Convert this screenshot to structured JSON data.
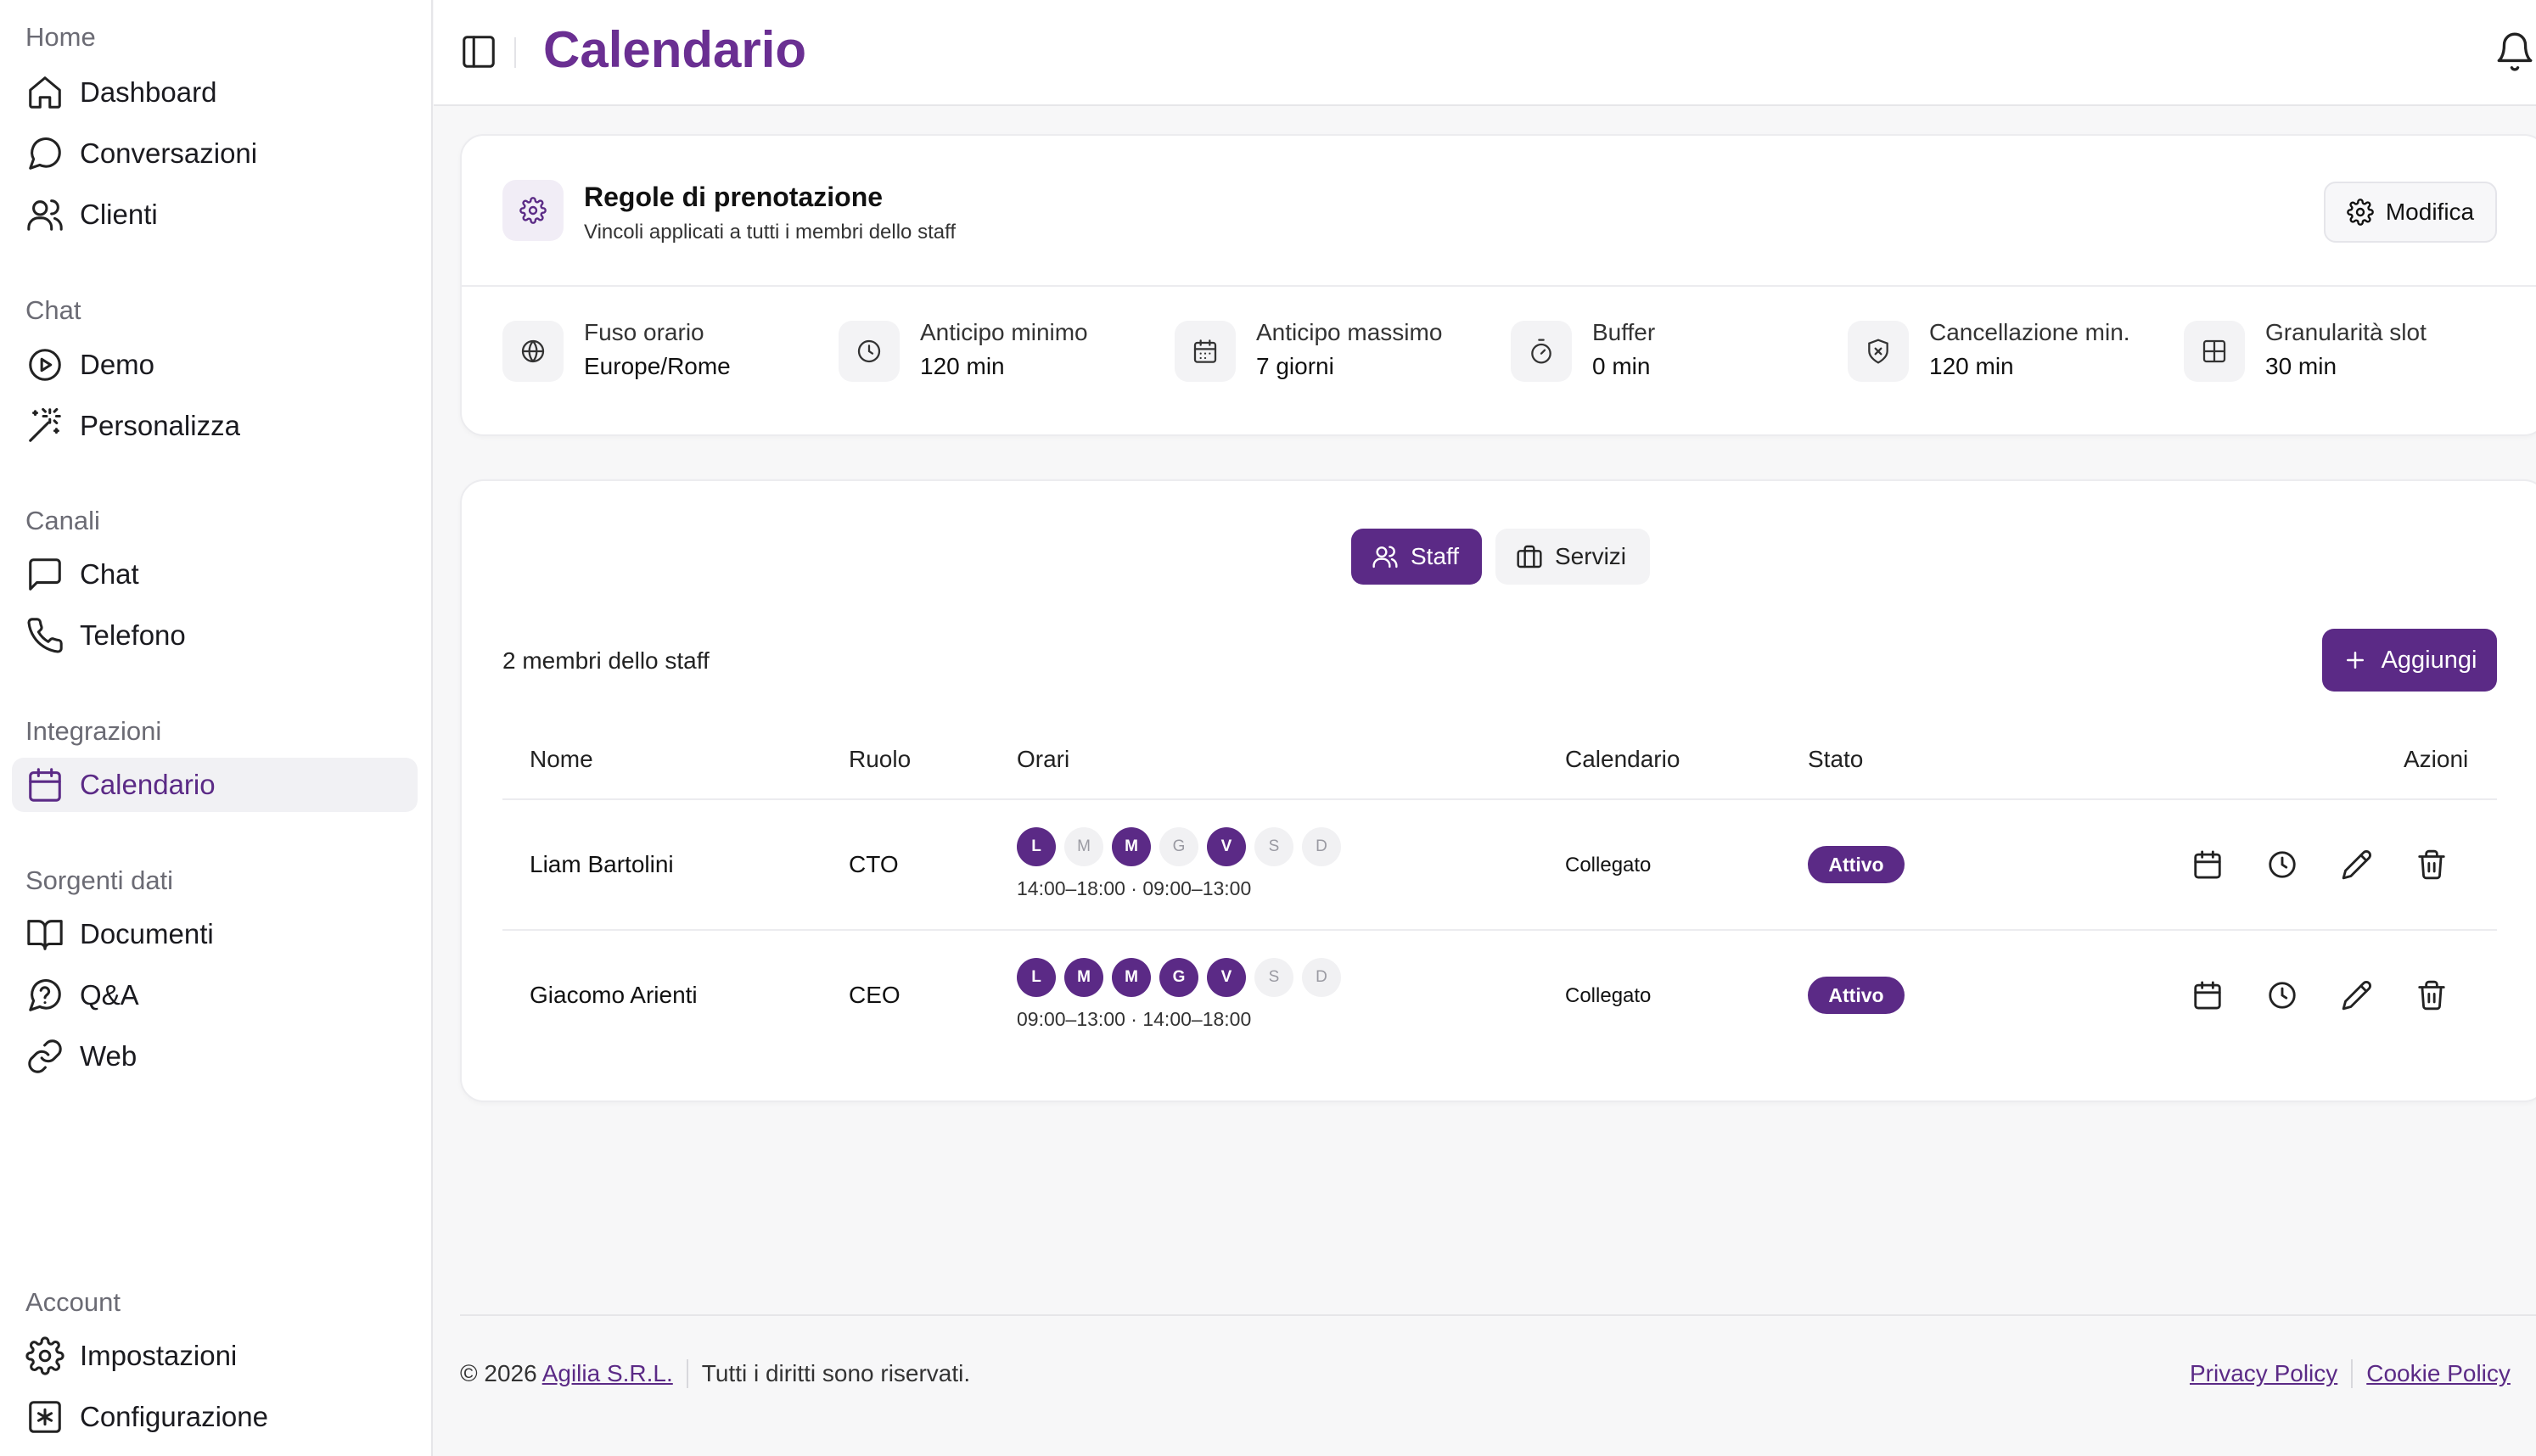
{
  "sidebar": {
    "groups": [
      {
        "title": "Home",
        "items": [
          {
            "label": "Dashboard"
          },
          {
            "label": "Conversazioni"
          },
          {
            "label": "Clienti"
          }
        ]
      },
      {
        "title": "Chat",
        "items": [
          {
            "label": "Demo"
          },
          {
            "label": "Personalizza"
          }
        ]
      },
      {
        "title": "Canali",
        "items": [
          {
            "label": "Chat"
          },
          {
            "label": "Telefono"
          }
        ]
      },
      {
        "title": "Integrazioni",
        "items": [
          {
            "label": "Calendario"
          }
        ]
      },
      {
        "title": "Sorgenti dati",
        "items": [
          {
            "label": "Documenti"
          },
          {
            "label": "Q&A"
          },
          {
            "label": "Web"
          }
        ]
      },
      {
        "title": "Account",
        "items": [
          {
            "label": "Impostazioni"
          },
          {
            "label": "Configurazione"
          }
        ]
      }
    ]
  },
  "header": {
    "title": "Calendario"
  },
  "rules": {
    "title": "Regole di prenotazione",
    "subtitle": "Vincoli applicati a tutti i membri dello staff",
    "edit_label": "Modifica",
    "items": [
      {
        "key": "Fuso orario",
        "value": "Europe/Rome"
      },
      {
        "key": "Anticipo minimo",
        "value": "120 min"
      },
      {
        "key": "Anticipo massimo",
        "value": "7 giorni"
      },
      {
        "key": "Buffer",
        "value": "0 min"
      },
      {
        "key": "Cancellazione min.",
        "value": "120 min"
      },
      {
        "key": "Granularità slot",
        "value": "30 min"
      }
    ]
  },
  "tabs": [
    {
      "label": "Staff"
    },
    {
      "label": "Servizi"
    }
  ],
  "staff": {
    "count_text": "2 membri dello staff",
    "add_label": "Aggiungi",
    "columns": [
      "Nome",
      "Ruolo",
      "Orari",
      "Calendario",
      "Stato",
      "Azioni"
    ],
    "rows": [
      {
        "name": "Liam Bartolini",
        "role": "CTO",
        "days": [
          {
            "letter": "L",
            "active": true
          },
          {
            "letter": "M",
            "active": false
          },
          {
            "letter": "M",
            "active": true
          },
          {
            "letter": "G",
            "active": false
          },
          {
            "letter": "V",
            "active": true
          },
          {
            "letter": "S",
            "active": false
          },
          {
            "letter": "D",
            "active": false
          }
        ],
        "hours": "14:00–18:00 · 09:00–13:00",
        "calendar": "Collegato",
        "status": "Attivo"
      },
      {
        "name": "Giacomo Arienti",
        "role": "CEO",
        "days": [
          {
            "letter": "L",
            "active": true
          },
          {
            "letter": "M",
            "active": true
          },
          {
            "letter": "M",
            "active": true
          },
          {
            "letter": "G",
            "active": true
          },
          {
            "letter": "V",
            "active": true
          },
          {
            "letter": "S",
            "active": false
          },
          {
            "letter": "D",
            "active": false
          }
        ],
        "hours": "09:00–13:00 · 14:00–18:00",
        "calendar": "Collegato",
        "status": "Attivo"
      }
    ]
  },
  "footer": {
    "copyright": "© 2026",
    "company": "Agilia S.R.L.",
    "rights": "Tutti i diritti sono riservati.",
    "privacy": "Privacy Policy",
    "cookie": "Cookie Policy"
  },
  "colors": {
    "accent": "#5b2a86",
    "title": "#6a2f92"
  }
}
